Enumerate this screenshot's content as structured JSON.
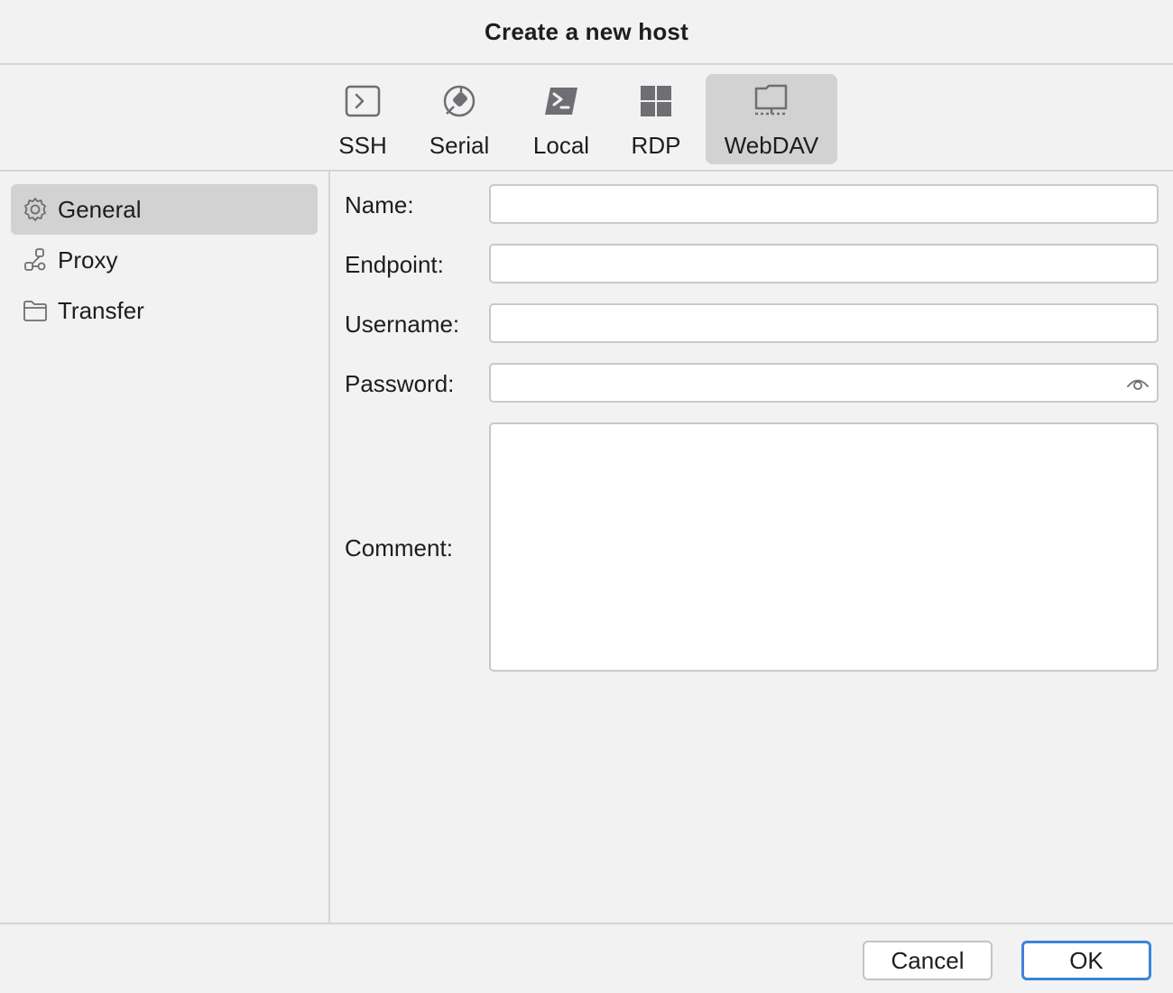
{
  "dialog": {
    "title": "Create a new host"
  },
  "host_types": [
    {
      "label": "SSH",
      "icon": "terminal-prompt-icon",
      "selected": false
    },
    {
      "label": "Serial",
      "icon": "plug-icon",
      "selected": false
    },
    {
      "label": "Local",
      "icon": "powershell-icon",
      "selected": false
    },
    {
      "label": "RDP",
      "icon": "windows-grid-icon",
      "selected": false
    },
    {
      "label": "WebDAV",
      "icon": "network-folder-icon",
      "selected": true
    }
  ],
  "sidebar": {
    "items": [
      {
        "label": "General",
        "icon": "gear-icon",
        "selected": true
      },
      {
        "label": "Proxy",
        "icon": "network-nodes-icon",
        "selected": false
      },
      {
        "label": "Transfer",
        "icon": "folder-icon",
        "selected": false
      }
    ]
  },
  "form": {
    "name_label": "Name:",
    "name_value": "",
    "endpoint_label": "Endpoint:",
    "endpoint_value": "",
    "username_label": "Username:",
    "username_value": "",
    "password_label": "Password:",
    "password_value": "",
    "password_toggle_icon": "eye-icon",
    "comment_label": "Comment:",
    "comment_value": ""
  },
  "footer": {
    "cancel_label": "Cancel",
    "ok_label": "OK"
  },
  "colors": {
    "background": "#f2f2f2",
    "selected": "#d2d2d2",
    "icon": "#6e6e73",
    "default_button_border": "#3c84d9"
  }
}
